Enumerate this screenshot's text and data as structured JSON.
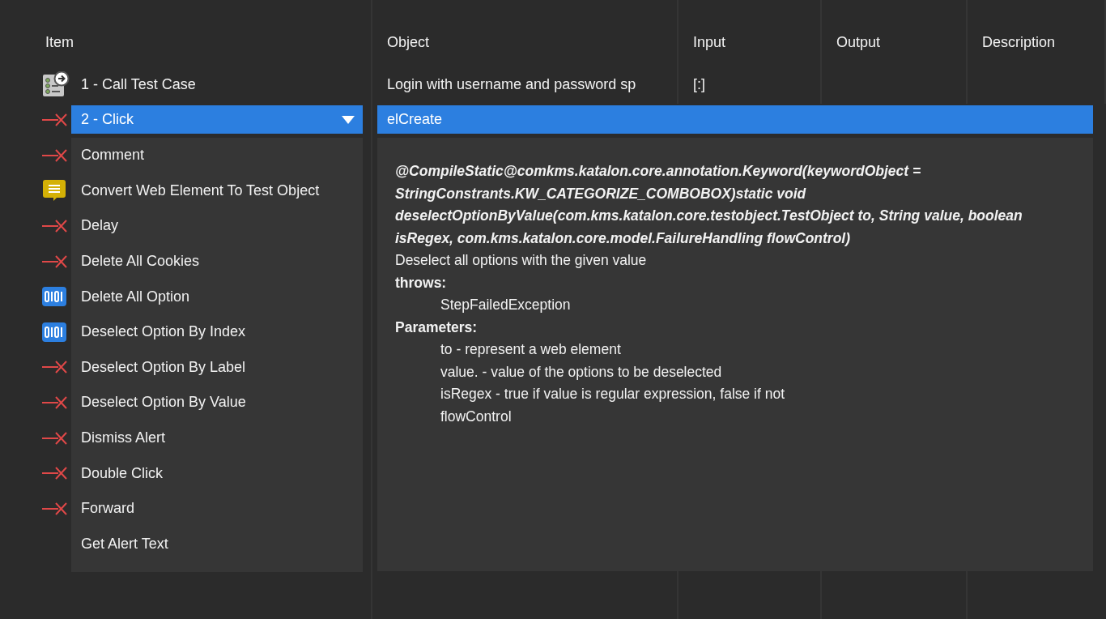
{
  "columns": [
    "Item",
    "Object",
    "Input",
    "Output",
    "Description"
  ],
  "rows": [
    {
      "kind": "call",
      "item": "1 - Call Test Case",
      "object": "Login with username and password sp",
      "input": "[:]"
    }
  ],
  "editor": {
    "item": "2 - Click",
    "object": "elCreate"
  },
  "dropdown": [
    {
      "kind": "cross",
      "label": "Comment"
    },
    {
      "kind": "comment",
      "label": "Convert Web Element To Test Object"
    },
    {
      "kind": "cross",
      "label": "Delay"
    },
    {
      "kind": "cross",
      "label": "Delete All Cookies"
    },
    {
      "kind": "binary",
      "label": "Delete All Option"
    },
    {
      "kind": "binary",
      "label": "Deselect Option By Index"
    },
    {
      "kind": "cross",
      "label": "Deselect Option By Label"
    },
    {
      "kind": "cross",
      "label": "Deselect Option By Value"
    },
    {
      "kind": "cross",
      "label": "Dismiss Alert"
    },
    {
      "kind": "cross",
      "label": "Double Click"
    },
    {
      "kind": "cross",
      "label": "Forward"
    },
    {
      "kind": "plain",
      "label": "Get Alert Text"
    }
  ],
  "doc": {
    "signature": "@CompileStatic@comkms.katalon.core.annotation.Keyword(keywordObject = StringConstrants.KW_CATEGORIZE_COMBOBOX)static void deselectOptionByValue(com.kms.katalon.core.testobject.TestObject to, String value, boolean isRegex, com.kms.katalon.core.model.FailureHandling flowControl)",
    "description": "Deselect all options with the given value",
    "throws_label": "throws:",
    "throws": [
      "StepFailedException"
    ],
    "params_label": "Parameters:",
    "params": [
      "to - represent a web element",
      "value. - value of the options to be deselected",
      "isRegex - true if value is regular expression, false if not",
      "flowControl"
    ]
  }
}
